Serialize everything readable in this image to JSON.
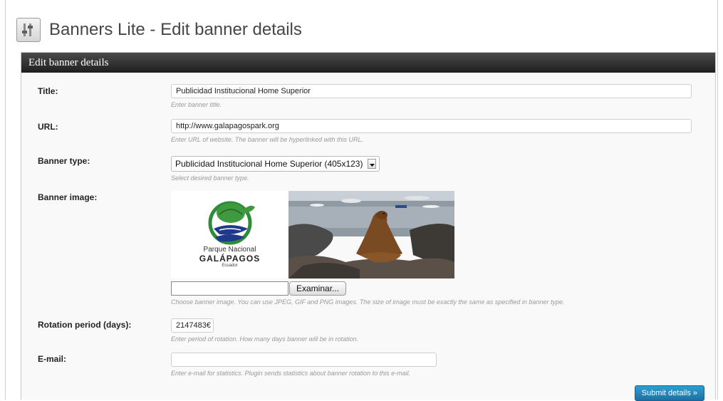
{
  "page": {
    "title": "Banners Lite - Edit banner details"
  },
  "panel": {
    "title": "Edit banner details"
  },
  "fields": {
    "title": {
      "label": "Title:",
      "value": "Publicidad Institucional Home Superior",
      "hint": "Enter banner title."
    },
    "url": {
      "label": "URL:",
      "value": "http://www.galapagospark.org",
      "hint": "Enter URL of website. The banner will be hyperlinked with this URL."
    },
    "banner_type": {
      "label": "Banner type:",
      "selected": "Publicidad Institucional Home Superior (405x123)",
      "hint": "Select desired banner type."
    },
    "banner_image": {
      "label": "Banner image:",
      "logo_line1": "Parque Nacional",
      "logo_line2": "GALÁPAGOS",
      "logo_line3": "Ecuador",
      "browse_label": "Examinar...",
      "hint": "Choose banner image. You can use JPEG, GIF and PNG images. The size of image must be exactly the same as specified in banner type."
    },
    "rotation": {
      "label": "Rotation period (days):",
      "value": "2147483€",
      "hint": "Enter period of rotation. How many days banner will be in rotation."
    },
    "email": {
      "label": "E-mail:",
      "value": "",
      "hint": "Enter e-mail for statistics. Plugin sends statistics about banner rotation to this e-mail."
    }
  },
  "submit_label": "Submit details »",
  "colors": {
    "submit": "#2385bd",
    "panel_header": "#2b2b2b",
    "logo_green": "#2e8b3a",
    "logo_blue": "#1f3a8a"
  }
}
